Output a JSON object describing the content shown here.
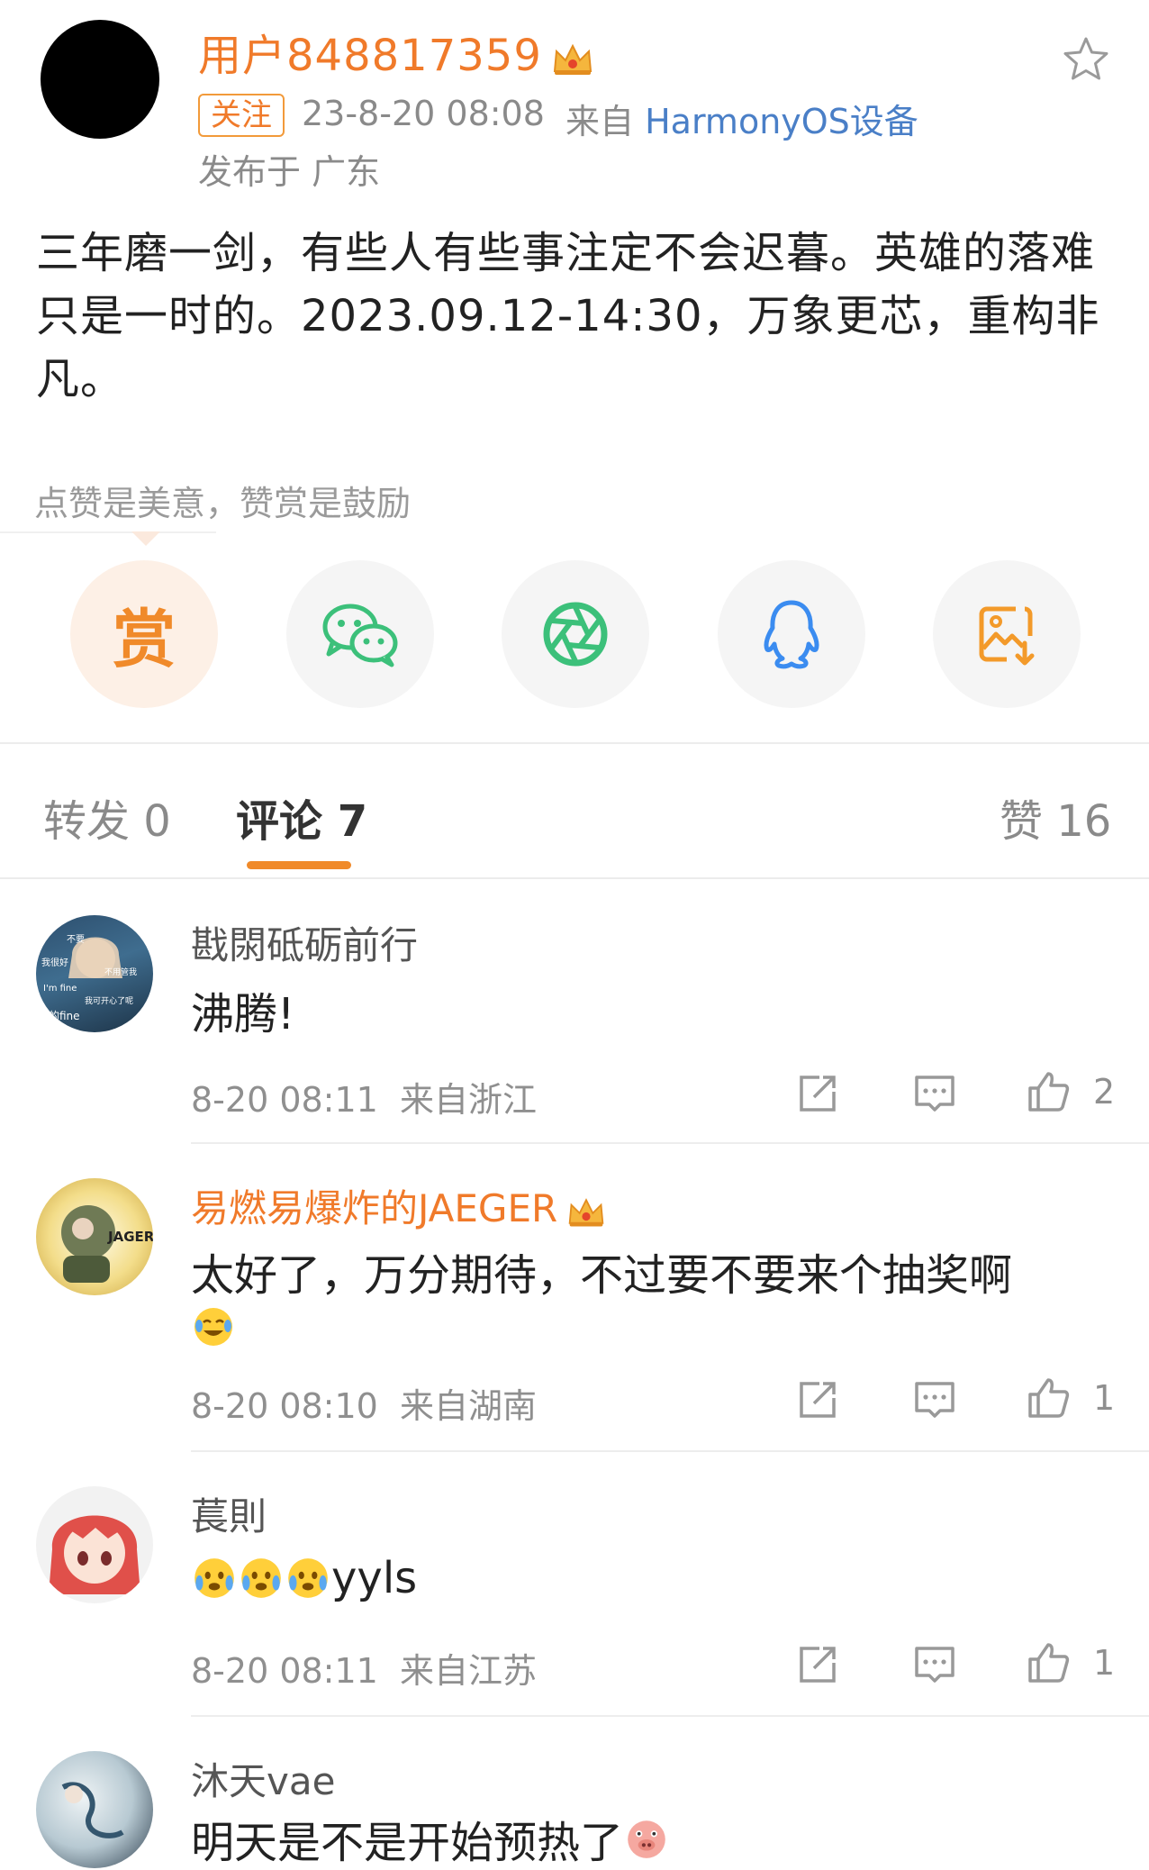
{
  "post": {
    "username": "用户848817359",
    "follow_label": "关注",
    "time": "23-8-20 08:08",
    "source_prefix": "来自",
    "source_device": "HarmonyOS设备",
    "location": "发布于 广东",
    "content": "三年磨一剑，有些人有些事注定不会迟暮。英雄的落难只是一时的。2023.09.12-14:30，万象更芯，重构非凡。"
  },
  "reward_tip": "点赞是美意，赞赏是鼓励",
  "share": {
    "reward_label": "赏"
  },
  "tabs": {
    "repost": "转发 0",
    "comment": "评论 7",
    "like": "赞 16"
  },
  "comments": [
    {
      "name": "戡閖砥砺前行",
      "text": "沸腾!",
      "time": "8-20 08:11",
      "location": "来自浙江",
      "likes": "2",
      "avatar_text": [
        "不要",
        "我很好",
        "不用管我",
        "I'm fine",
        "我可开心了呢",
        "的fine"
      ]
    },
    {
      "name": "易燃易爆炸的JAEGER",
      "text": "太好了，万分期待，不过要不要来个抽奖啊",
      "time": "8-20 08:10",
      "location": "来自湖南",
      "likes": "1",
      "avatar_text": [
        "JAGER"
      ]
    },
    {
      "name": "萇則",
      "text": "yyls",
      "time": "8-20 08:11",
      "location": "来自江苏",
      "likes": "1"
    },
    {
      "name": "沐天vae",
      "text": "明天是不是开始预热了"
    }
  ],
  "colors": {
    "accent": "#f08a2a",
    "link": "#4a7fc7",
    "wechat": "#3cc07a",
    "qq": "#3b8cf0"
  }
}
